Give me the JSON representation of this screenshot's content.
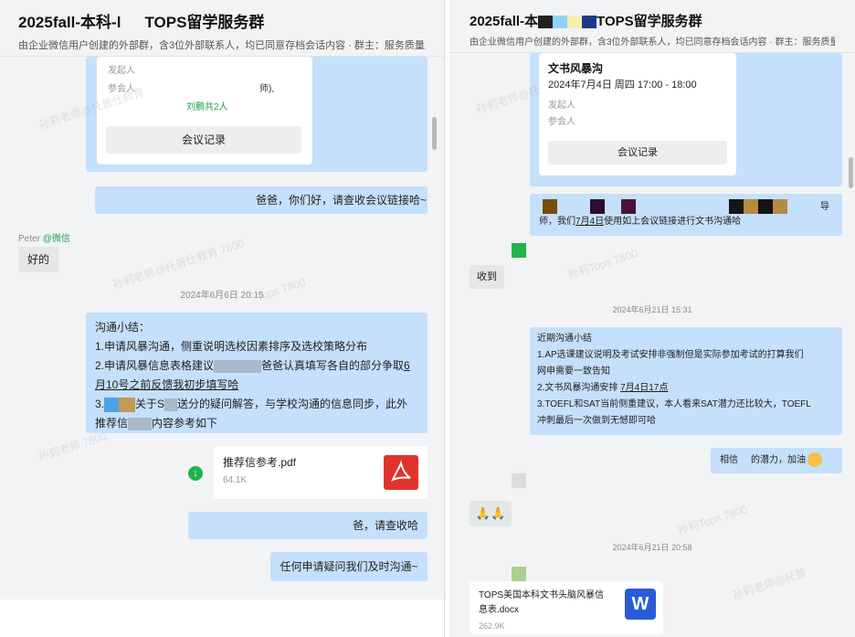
{
  "left": {
    "title": "2025fall-本科-l",
    "title_suffix": "TOPS留学服务群",
    "subtitle": "由企业微信用户创建的外部群，含3位外部联系人，均已同意存档会话内容 · 群主：服务质量监督",
    "meeting_card": {
      "organizer_label": "发起人",
      "attendees_label": "参会人",
      "attendees_tail": "师),",
      "count_text": "刘鹏共2人",
      "record_button": "会议记录"
    },
    "msg_meeting_link": "爸爸，你们好，请查收会议链接哈~",
    "sender_peter": "Peter",
    "sender_peter_tag": "@微信",
    "reply_ok": "好的",
    "timestamp": "2024年6月6日 20:15",
    "summary": {
      "title": "沟通小结：",
      "line1": "1.申请风暴沟通，侧重说明选校因素排序及选校策略分布",
      "line2_a": "2.申请风暴信息表格建议",
      "line2_b": "爸爸认真填写各自的部分争取",
      "line2_c": "6",
      "line3": "月10号之前反馈我初步填写哈",
      "line4_a": "3.",
      "line4_b": "关于S",
      "line4_c": "送分的疑问解答，与学校沟通的信息同步，此外",
      "line5_a": "推荐信",
      "line5_b": "内容参考如下"
    },
    "file_pdf": {
      "name": "推荐信参考.pdf",
      "size": "64.1K",
      "icon": "pdf-icon"
    },
    "msg_please_receive": "爸，请查收哈",
    "msg_contact": "任何申请疑问我们及时沟通~"
  },
  "right": {
    "title": "2025fall-本",
    "title_suffix": "TOPS留学服务群",
    "subtitle": "由企业微信用户创建的外部群，含3位外部联系人，均已同意存档会话内容 · 群主：服务质量监督",
    "meeting_card": {
      "title": "文书风暴沟",
      "time": "2024年7月4日 周四 17:00 - 18:00",
      "organizer_label": "发起人",
      "attendees_label": "参会人",
      "record_button": "会议记录"
    },
    "msg_link_tail": "导",
    "msg_link_line2_a": "师，我们",
    "msg_link_date": "7月4日",
    "msg_link_line2_b": "使用如上会议链接进行文书沟通哈",
    "reply_received": "收到",
    "timestamp1": "2024年6月21日 15:31",
    "summary": {
      "title": "近期沟通小结",
      "line1": "1.AP选课建议说明及考试安排非强制但是实际参加考试的打算我们",
      "line2": "网申需要一致告知",
      "line3_a": "2.文书风暴沟通安排",
      "line3_b": "7月4日17点",
      "line4": "3.TOEFL和SAT当前侧重建议，本人看来SAT潜力还比较大，TOEFL",
      "line5": "冲刺最后一次做到无憾即可哈"
    },
    "msg_believe_a": "相信",
    "msg_believe_b": "的潜力，加油",
    "emoji_reply": "🙏🙏",
    "timestamp2": "2024年6月21日 20:58",
    "file_docx": {
      "name_line1": "TOPS美国本科文书头脑风暴信",
      "name_line2": "息表.docx",
      "size": "262.9K",
      "icon": "word-icon"
    },
    "word_letter": "W"
  },
  "colors": {
    "bubble": "#c5e0fb",
    "background": "#f2f3f5",
    "accent_green": "#1fb44a",
    "pdf_red": "#e0332c",
    "word_blue": "#2a5bd7"
  }
}
